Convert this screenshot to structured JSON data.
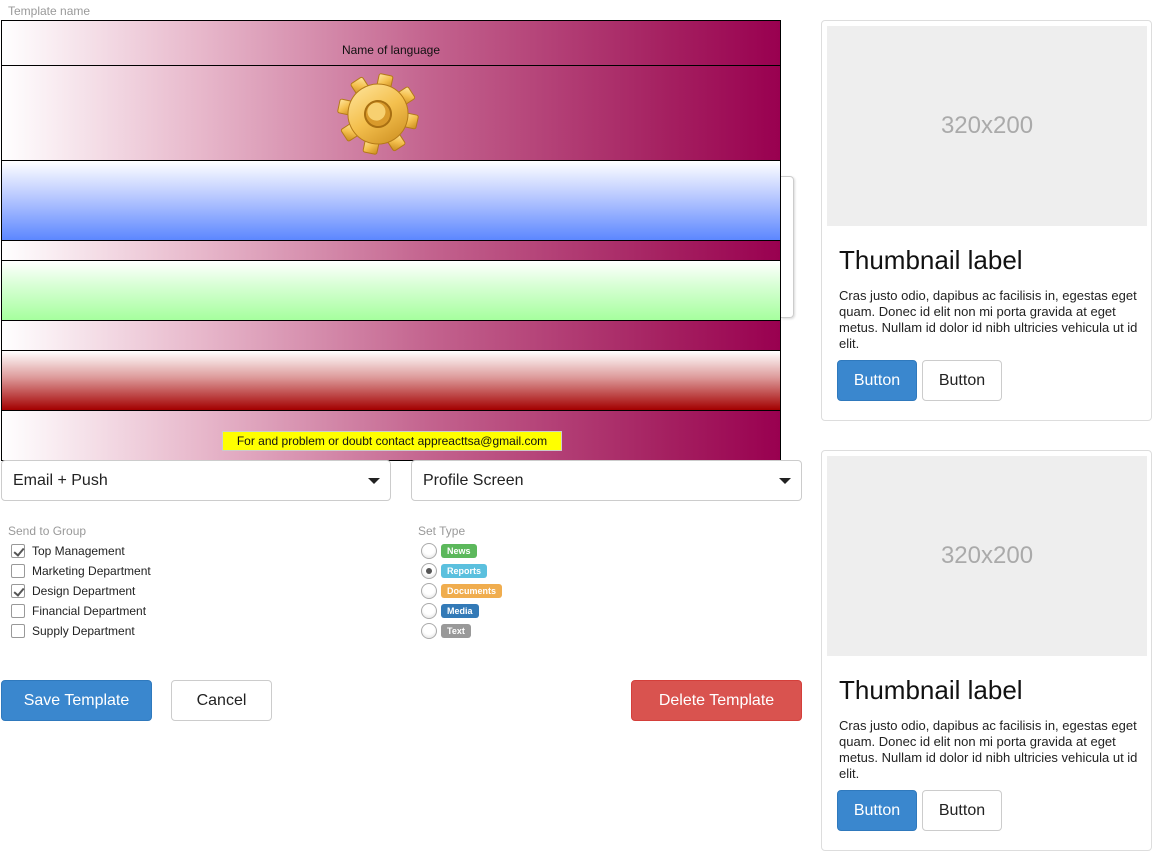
{
  "template": {
    "label": "Template name"
  },
  "banners": {
    "language_text": "Name of language",
    "contact_text": "For and problem or doubt contact appreacttsa@gmail.com",
    "gear_icon": "gear-icon"
  },
  "selects": {
    "channel": {
      "value": "Email + Push"
    },
    "screen": {
      "value": "Profile Screen"
    }
  },
  "send_to_group": {
    "title": "Send to Group",
    "items": [
      {
        "label": "Top Management",
        "checked": true
      },
      {
        "label": "Marketing Department",
        "checked": false
      },
      {
        "label": "Design Department",
        "checked": true
      },
      {
        "label": "Financial Department",
        "checked": false
      },
      {
        "label": "Supply Department",
        "checked": false
      }
    ]
  },
  "set_type": {
    "title": "Set Type",
    "items": [
      {
        "label": "News",
        "color": "#5cb85c",
        "selected": false
      },
      {
        "label": "Reports",
        "color": "#5bc0de",
        "selected": true
      },
      {
        "label": "Documents",
        "color": "#f0ad4e",
        "selected": false
      },
      {
        "label": "Media",
        "color": "#337ab7",
        "selected": false
      },
      {
        "label": "Text",
        "color": "#999999",
        "selected": false
      }
    ]
  },
  "actions": {
    "save": "Save Template",
    "cancel": "Cancel",
    "delete": "Delete Template"
  },
  "cards": [
    {
      "image_text": "320x200",
      "title": "Thumbnail label",
      "text": "Cras justo odio, dapibus ac facilisis in, egestas eget quam. Donec id elit non mi porta gravida at eget metus. Nullam id dolor id nibh ultricies vehicula ut id elit.",
      "primary": "Button",
      "secondary": "Button"
    },
    {
      "image_text": "320x200",
      "title": "Thumbnail label",
      "text": "Cras justo odio, dapibus ac facilisis in, egestas eget quam. Donec id elit non mi porta gravida at eget metus. Nullam id dolor id nibh ultricies vehicula ut id elit.",
      "primary": "Button",
      "secondary": "Button"
    }
  ]
}
